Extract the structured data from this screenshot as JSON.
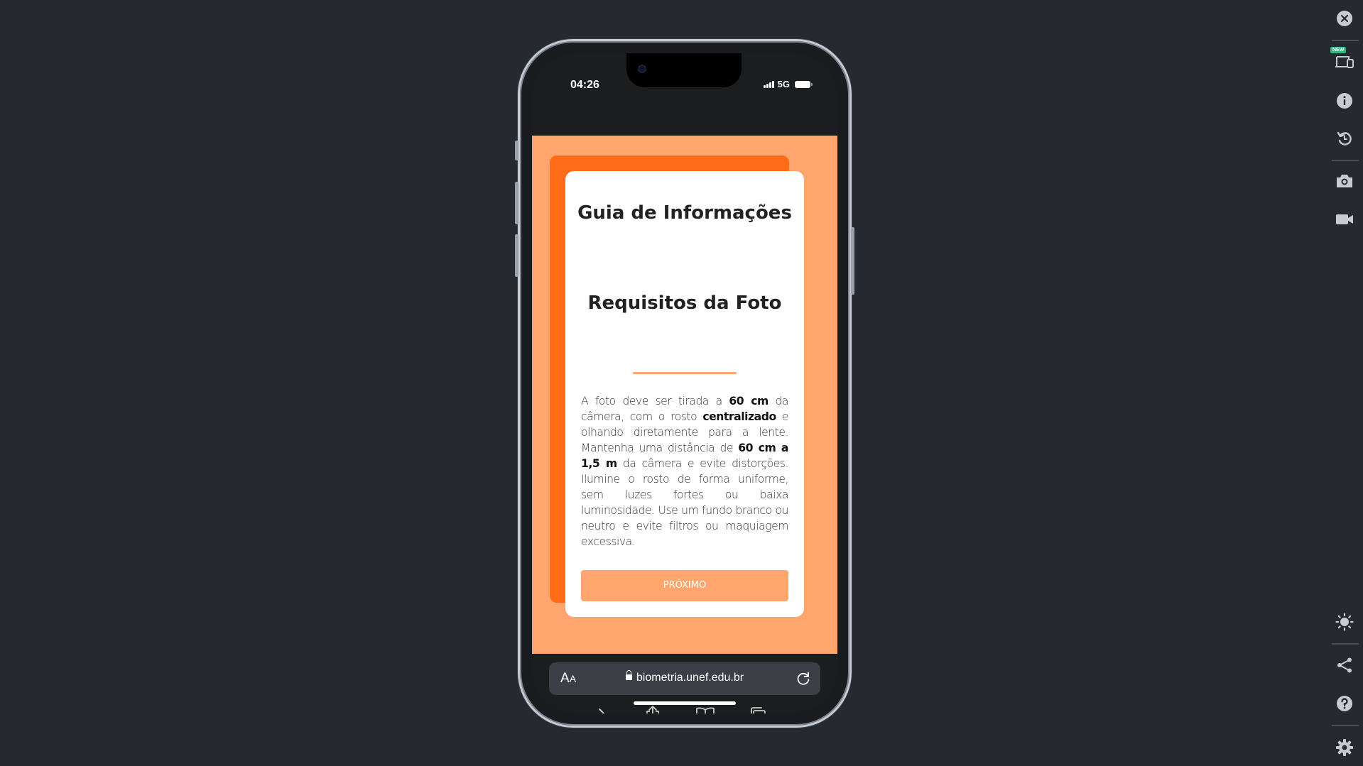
{
  "status_bar": {
    "time": "04:26",
    "network": "5G"
  },
  "page": {
    "title": "Guia de Informações",
    "subtitle": "Requisitos da Foto",
    "body": [
      {
        "text": "A foto deve ser tirada a ",
        "bold": false
      },
      {
        "text": "60 cm",
        "bold": true
      },
      {
        "text": " da câmera, com o rosto ",
        "bold": false
      },
      {
        "text": "centralizado",
        "bold": true
      },
      {
        "text": " e olhando diretamente para a lente. Mantenha uma distância de ",
        "bold": false
      },
      {
        "text": "60 cm a 1,5 m",
        "bold": true
      },
      {
        "text": " da câmera e evite distorções. Ilumine o rosto de forma uniforme, sem luzes fortes ou baixa luminosidade. Use um fundo branco ou neutro e evite filtros ou maquiagem excessiva.",
        "bold": false
      }
    ],
    "next_button": "PRÓXIMO"
  },
  "browser": {
    "aa_label": "A",
    "aa_small": "A",
    "url": "biometria.unef.edu.br"
  },
  "rail": {
    "new_badge": "NEW"
  },
  "colors": {
    "background": "#262a30",
    "page_bg": "#ffa56d",
    "accent_dark": "#ff6b17",
    "card": "#ffffff",
    "button": "#ffa56d"
  },
  "icons": [
    "close-icon",
    "responsive-devices-icon",
    "info-icon",
    "rotate-icon",
    "camera-icon",
    "video-icon",
    "brightness-icon",
    "share-icon",
    "help-icon",
    "settings-icon",
    "back-icon",
    "forward-icon",
    "share-up-icon",
    "bookmarks-icon",
    "tabs-icon",
    "reload-icon",
    "lock-icon"
  ]
}
